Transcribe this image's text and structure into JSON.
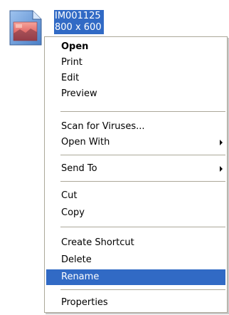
{
  "file": {
    "name": "IM001125",
    "dimensions": "800 x 600",
    "icon": "image-file-icon"
  },
  "menu": {
    "items": [
      {
        "label": "Open"
      },
      {
        "label": "Print"
      },
      {
        "label": "Edit"
      },
      {
        "label": "Preview"
      },
      {
        "label": "Scan for Viruses..."
      },
      {
        "label": "Open With"
      },
      {
        "label": "Send To"
      },
      {
        "label": "Cut"
      },
      {
        "label": "Copy"
      },
      {
        "label": "Create Shortcut"
      },
      {
        "label": "Delete"
      },
      {
        "label": "Rename"
      },
      {
        "label": "Properties"
      }
    ]
  },
  "colors": {
    "selection": "#316ac5",
    "menu_border": "#aca899"
  }
}
